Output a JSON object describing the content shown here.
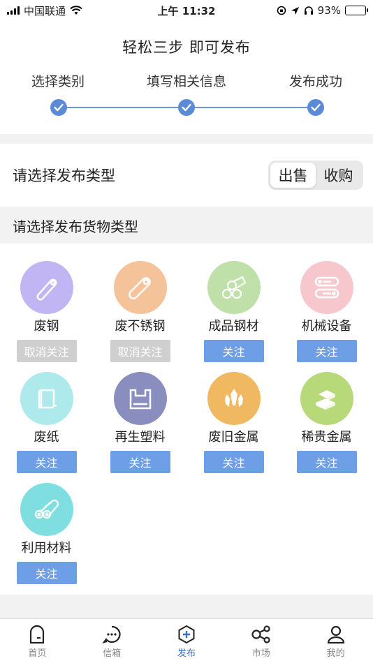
{
  "status_bar": {
    "carrier": "中国联通",
    "time": "上午 11:32",
    "battery": "93%"
  },
  "steps": {
    "title": "轻松三步  即可发布",
    "labels": [
      "选择类别",
      "填写相关信息",
      "发布成功"
    ]
  },
  "publish_type": {
    "label": "请选择发布类型",
    "options": [
      "出售",
      "收购"
    ],
    "selected": "出售"
  },
  "goods_header": "请选择发布货物类型",
  "goods": [
    {
      "name": "废钢",
      "button": "取消关注",
      "followed": true,
      "color": "#c2b5f3",
      "icon": "steel-pipe-icon"
    },
    {
      "name": "废不锈钢",
      "button": "取消关注",
      "followed": true,
      "color": "#f5c39a",
      "icon": "stainless-bar-icon"
    },
    {
      "name": "成品钢材",
      "button": "关注",
      "followed": false,
      "color": "#bfe0a9",
      "icon": "steel-coil-icon"
    },
    {
      "name": "机械设备",
      "button": "关注",
      "followed": false,
      "color": "#f6c8cd",
      "icon": "machinery-icon"
    },
    {
      "name": "废纸",
      "button": "关注",
      "followed": false,
      "color": "#aee9ec",
      "icon": "paper-scroll-icon"
    },
    {
      "name": "再生塑料",
      "button": "关注",
      "followed": false,
      "color": "#8a8ebf",
      "icon": "plastic-bag-icon"
    },
    {
      "name": "废旧金属",
      "button": "关注",
      "followed": false,
      "color": "#f0b860",
      "icon": "metal-crystal-icon"
    },
    {
      "name": "稀贵金属",
      "button": "关注",
      "followed": false,
      "color": "#b7d97a",
      "icon": "gold-bar-icon"
    },
    {
      "name": "利用材料",
      "button": "关注",
      "followed": false,
      "color": "#7fdfe0",
      "icon": "material-roll-icon"
    }
  ],
  "tabs": [
    {
      "label": "首页",
      "icon": "home-icon"
    },
    {
      "label": "信箱",
      "icon": "message-icon"
    },
    {
      "label": "发布",
      "icon": "publish-icon",
      "active": true
    },
    {
      "label": "市场",
      "icon": "market-icon"
    },
    {
      "label": "我的",
      "icon": "profile-icon"
    }
  ],
  "colors": {
    "accent": "#6e9ee6",
    "muted_button": "#cfcfcf",
    "tab_active": "#3a6fd1"
  }
}
